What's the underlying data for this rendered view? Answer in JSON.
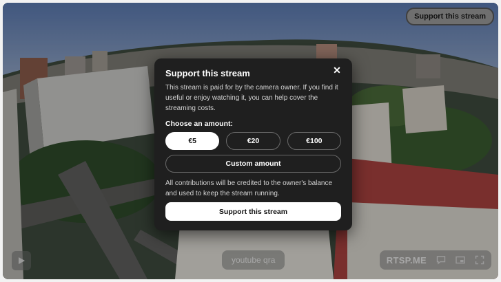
{
  "header": {
    "support_label": "Support this stream"
  },
  "modal": {
    "title": "Support this stream",
    "description": "This stream is paid for by the camera owner. If you find it useful or enjoy watching it, you can help cover the streaming costs.",
    "choose_label": "Choose an amount:",
    "amounts": [
      {
        "label": "€5",
        "selected": true
      },
      {
        "label": "€20",
        "selected": false
      },
      {
        "label": "€100",
        "selected": false
      }
    ],
    "custom_label": "Custom amount",
    "note": "All contributions will be credited to the owner's balance and used to keep the stream running.",
    "submit_label": "Support this stream"
  },
  "player": {
    "channel_label": "youtube qra",
    "brand": "RTSP.ME",
    "icons": [
      "play-icon",
      "chat-icon",
      "picture-in-picture-icon",
      "fullscreen-icon"
    ]
  }
}
